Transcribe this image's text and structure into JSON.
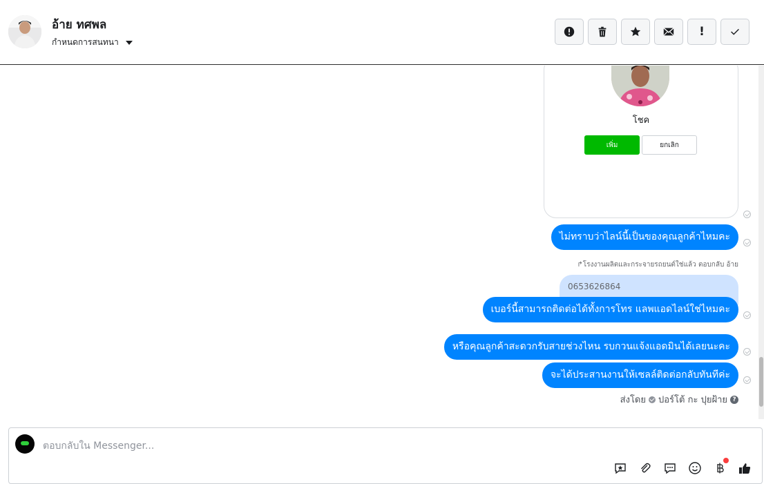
{
  "header": {
    "contact_name": "อ้าย ทศพล",
    "assign_label": "กำหนดการสนทนา",
    "actions": [
      {
        "name": "spam-button",
        "icon": "exclamation-circle-icon"
      },
      {
        "name": "delete-button",
        "icon": "trash-icon"
      },
      {
        "name": "star-button",
        "icon": "star-icon"
      },
      {
        "name": "mark-unread-button",
        "icon": "envelope-icon"
      },
      {
        "name": "follow-up-button",
        "icon": "exclamation-icon",
        "label": "!"
      },
      {
        "name": "done-button",
        "icon": "checkmark-icon"
      }
    ]
  },
  "card": {
    "name": "โชค",
    "add_label": "เพิ่ม",
    "cancel_label": "ยกเลิก"
  },
  "messages": [
    "ไม่ทราบว่าไลน์นี้เป็นของคุณลูกค้าไหมคะ",
    "เบอร์นี้สามารถติดต่อได้ทั้งการโทร แลพแอดไลน์ใช่ไหมคะ",
    "หรือคุณลูกค้าสะดวกรับสายช่วงไหน รบกวนแจ้งแอดมินได้เลยนะคะ",
    "จะได้ประสานงานให้เซลล์ติดต่อกลับทันทีค่ะ"
  ],
  "reply": {
    "note": "โรงงานผลิตและกระจายรถยนต์ใช่แล้ว ตอบกลับ อ้าย",
    "quoted": "0653626864"
  },
  "sent_by": {
    "prefix": "ส่งโดย",
    "name": "ปอร์โต้ กะ ปุยฝ้าย",
    "help": "?"
  },
  "composer": {
    "placeholder": "ตอบกลับใน Messenger..."
  },
  "colors": {
    "bubble": "#0084ff",
    "add_button": "#00b900",
    "quote_bg": "#cfe3ff"
  }
}
